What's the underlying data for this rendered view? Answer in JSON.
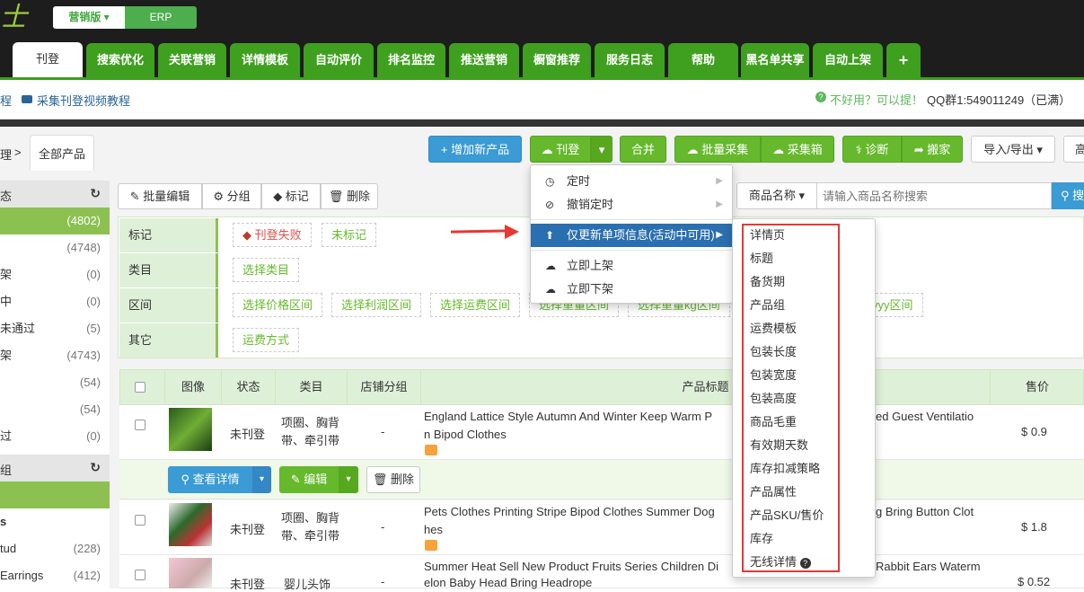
{
  "header": {
    "logo_text": "士",
    "version_btn": "营销版 ▾",
    "erp_btn": "ERP"
  },
  "nav": {
    "tabs": [
      "刊登",
      "搜索优化",
      "关联营销",
      "详情模板",
      "自动评价",
      "排名监控",
      "推送营销",
      "橱窗推荐",
      "服务日志",
      "帮助",
      "黑名单共享",
      "自动上架",
      "+"
    ]
  },
  "info": {
    "left_fragment": "程",
    "video_link": "采集刊登视频教程",
    "feedback": "不好用？可以提！",
    "qq": "QQ群1:549011249（已满）"
  },
  "breadcrumb": {
    "prev": "理",
    "sep": ">",
    "tab_all": "全部产品"
  },
  "toolbar": {
    "add_product": "+ 增加新产品",
    "publish": "刊登",
    "merge": "合并",
    "batch_collect": "批量采集",
    "collect_box": "采集箱",
    "diagnose": "诊断",
    "move": "搬家",
    "import_export": "导入/导出 ▾",
    "high": "高"
  },
  "actions": {
    "batch_edit": "批量编辑",
    "group": "分组",
    "mark": "标记",
    "delete": "删除"
  },
  "search": {
    "field_select": "商品名称 ▾",
    "placeholder": "请输入商品名称搜索",
    "btn": "搜"
  },
  "sidebar": {
    "head1_fragment": "态",
    "items": [
      {
        "label": "",
        "count": "(4802)"
      },
      {
        "label": "",
        "count": "(4748)"
      },
      {
        "label": "架",
        "count": "(0)"
      },
      {
        "label": "中",
        "count": "(0)"
      },
      {
        "label": "未通过",
        "count": "(5)"
      },
      {
        "label": "架",
        "count": "(4743)"
      },
      {
        "label": "",
        "count": "(54)"
      },
      {
        "label": "",
        "count": "(54)"
      },
      {
        "label": "过",
        "count": "(0)"
      }
    ],
    "head2_fragment": "组",
    "groups": [
      {
        "label": "s",
        "count": ""
      },
      {
        "label": "tud",
        "count": "(228)"
      },
      {
        "label": " Earrings",
        "count": "(412)"
      }
    ]
  },
  "filters": {
    "mark_label": "标记",
    "mark_tags": [
      "刊登失败",
      "未标记"
    ],
    "cat_label": "类目",
    "cat_tags": [
      "选择类目"
    ],
    "range_label": "区间",
    "range_tags": [
      "选择价格区间",
      "选择利润区间",
      "选择运费区间",
      "选择重量区间",
      "选择重量kg区间",
      "yyy区间"
    ],
    "other_label": "其它",
    "other_tags": [
      "运费方式"
    ]
  },
  "table": {
    "headers": [
      "图像",
      "状态",
      "类目",
      "店铺分组",
      "产品标题",
      "售价"
    ],
    "rows": [
      {
        "status": "未刊登",
        "cat": "项圈、胸背带、牵引带",
        "group": "-",
        "title": "England Lattice Style Autumn And Winter Keep Warm P",
        "title_rest": "ed Guest Ventilatio",
        "title2": "n Bipod Clothes",
        "price": "$ 0.9"
      },
      {
        "status": "未刊登",
        "cat": "项圈、胸背带、牵引带",
        "group": "-",
        "title": "Pets Clothes Printing Stripe Bipod Clothes Summer Dog",
        "title_rest": "g Bring Button Clot",
        "title2": "hes",
        "price": "$ 1.8"
      },
      {
        "status": "未刊登",
        "cat": "婴儿头饰",
        "group": "-",
        "title": "Summer Heat Sell New Product Fruits Series Children Di",
        "title_rest": "Rabbit Ears Waterm",
        "title2": "elon Baby Head Bring Headrope",
        "price": "$ 0.52"
      }
    ],
    "row_actions": {
      "view": "查看详情",
      "edit": "编辑",
      "delete": "删除"
    }
  },
  "menu1": {
    "items": [
      "定时",
      "撤销定时",
      "仅更新单项信息(活动中可用)",
      "立即上架",
      "立即下架"
    ]
  },
  "menu2": {
    "items": [
      "详情页",
      "标题",
      "备货期",
      "产品组",
      "运费模板",
      "包装长度",
      "包装宽度",
      "包装高度",
      "商品毛重",
      "有效期天数",
      "库存扣减策略",
      "产品属性",
      "产品SKU/售价",
      "库存",
      "无线详情"
    ]
  },
  "colors": {
    "brand_green": "#3f9f1f",
    "accent_blue": "#2a6fb0",
    "highlight_red": "#e53935"
  }
}
